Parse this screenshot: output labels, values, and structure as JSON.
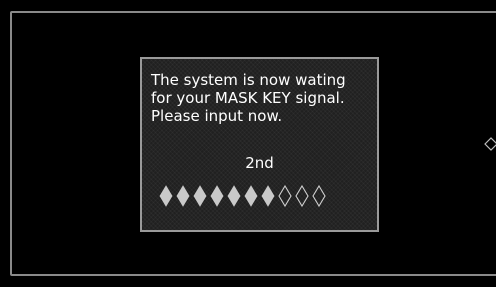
{
  "dialog": {
    "message_lines": [
      "The system is now wating",
      "for your MASK KEY signal.",
      "Please input now."
    ],
    "count_label": "2nd",
    "progress": {
      "filled": 7,
      "total": 10
    }
  },
  "colors": {
    "background": "#000000",
    "frame_border": "#8a8a8a",
    "dialog_fill": "#202020",
    "dialog_border": "#9a9a9a",
    "text": "#ffffff",
    "diamond_filled": "#c9c9c9",
    "diamond_empty_outline": "#d0d0d0"
  },
  "icons": {
    "progress_filled": "filled-diamond-icon",
    "progress_empty": "empty-diamond-icon",
    "edge_marker": "diamond-outline-icon"
  }
}
